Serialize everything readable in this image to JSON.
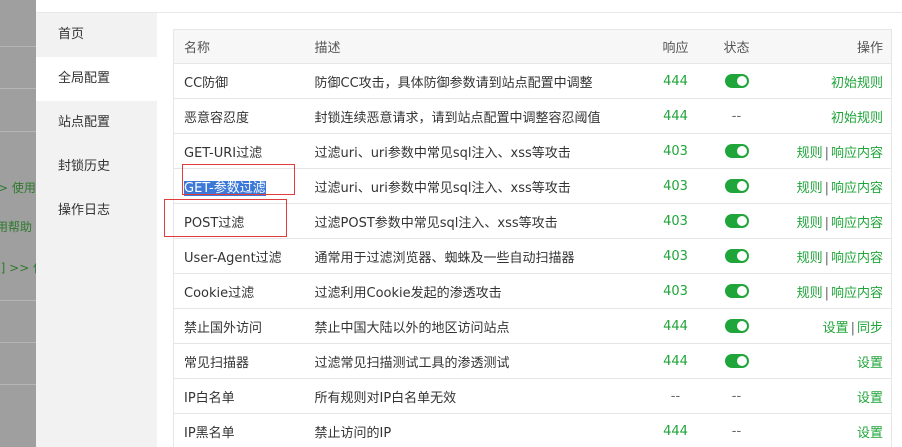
{
  "background": {
    "fragments": [
      "> 使用",
      "用帮助",
      "]] >> 使"
    ]
  },
  "sidebar": {
    "items": [
      {
        "label": "首页",
        "active": false
      },
      {
        "label": "全局配置",
        "active": true
      },
      {
        "label": "站点配置",
        "active": false
      },
      {
        "label": "封锁历史",
        "active": false
      },
      {
        "label": "操作日志",
        "active": false
      }
    ]
  },
  "table": {
    "headers": {
      "name": "名称",
      "desc": "描述",
      "resp": "响应",
      "status": "状态",
      "op": "操作"
    },
    "rows": [
      {
        "name": "CC防御",
        "desc": "防御CC攻击，具体防御参数请到站点配置中调整",
        "resp": "444",
        "status": "on",
        "ops": [
          "初始规则"
        ]
      },
      {
        "name": "恶意容忍度",
        "desc": "封锁连续恶意请求，请到站点配置中调整容忍阈值",
        "resp": "444",
        "status": "--",
        "ops": [
          "初始规则"
        ]
      },
      {
        "name": "GET-URI过滤",
        "desc": "过滤uri、uri参数中常见sql注入、xss等攻击",
        "resp": "403",
        "status": "on",
        "ops": [
          "规则",
          "响应内容"
        ]
      },
      {
        "name": "GET-参数过滤",
        "desc": "过滤uri、uri参数中常见sql注入、xss等攻击",
        "resp": "403",
        "status": "on",
        "ops": [
          "规则",
          "响应内容"
        ]
      },
      {
        "name": "POST过滤",
        "desc": "过滤POST参数中常见sql注入、xss等攻击",
        "resp": "403",
        "status": "on",
        "ops": [
          "规则",
          "响应内容"
        ]
      },
      {
        "name": "User-Agent过滤",
        "desc": "通常用于过滤浏览器、蜘蛛及一些自动扫描器",
        "resp": "403",
        "status": "on",
        "ops": [
          "规则",
          "响应内容"
        ]
      },
      {
        "name": "Cookie过滤",
        "desc": "过滤利用Cookie发起的渗透攻击",
        "resp": "403",
        "status": "on",
        "ops": [
          "规则",
          "响应内容"
        ]
      },
      {
        "name": "禁止国外访问",
        "desc": "禁止中国大陆以外的地区访问站点",
        "resp": "444",
        "status": "on",
        "ops": [
          "设置",
          "同步"
        ]
      },
      {
        "name": "常见扫描器",
        "desc": "过滤常见扫描测试工具的渗透测试",
        "resp": "444",
        "status": "on",
        "ops": [
          "设置"
        ]
      },
      {
        "name": "IP白名单",
        "desc": "所有规则对IP白名单无效",
        "resp": "--",
        "status": "--",
        "ops": [
          "设置"
        ]
      },
      {
        "name": "IP黑名单",
        "desc": "禁止访问的IP",
        "resp": "444",
        "status": "--",
        "ops": [
          "设置"
        ]
      }
    ],
    "separator": "|"
  },
  "colors": {
    "accent": "#20a53a",
    "selection": "#3b78d8",
    "annotation": "#e23b3b"
  },
  "icons": {
    "toggle": "toggle-switch-icon"
  }
}
